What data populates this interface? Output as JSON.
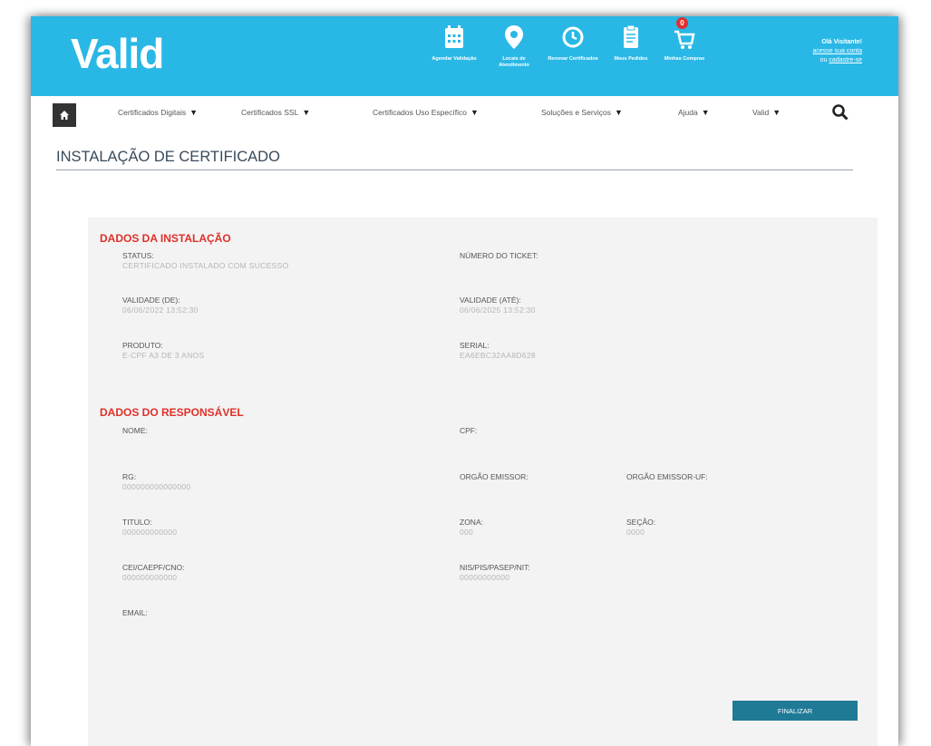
{
  "header": {
    "logo": "Valid",
    "icons": [
      {
        "name": "calendar-icon",
        "label": "Agendar Validação"
      },
      {
        "name": "location-pin-icon",
        "label": "Locais de Atendimento"
      },
      {
        "name": "renew-clock-icon",
        "label": "Renovar Certificados"
      },
      {
        "name": "clipboard-icon",
        "label": "Meus Pedidos"
      },
      {
        "name": "cart-icon",
        "label": "Minhas Compras"
      }
    ],
    "cart_count": "0",
    "user": {
      "greeting": "Olá Visitante!",
      "login_link": "acesse sua conta",
      "register_prefix": "ou",
      "register_link": "cadastre-se"
    }
  },
  "nav": {
    "items": [
      "Certificados Digitais",
      "Certificados SSL",
      "Certificados Uso Específico",
      "Soluções e Serviços",
      "Ajuda",
      "Valid"
    ]
  },
  "page": {
    "title": "INSTALAÇÃO DE CERTIFICADO"
  },
  "installation": {
    "heading": "DADOS DA INSTALAÇÃO",
    "status_label": "STATUS:",
    "status_value": "CERTIFICADO INSTALADO COM SUCESSO",
    "ticket_label": "NÚMERO DO TICKET:",
    "valid_from_label": "VALIDADE (DE):",
    "valid_from_value": "06/06/2022 13:52:30",
    "valid_to_label": "VALIDADE (ATÉ):",
    "valid_to_value": "06/06/2025 13:52:30",
    "product_label": "PRODUTO:",
    "product_value": "E-CPF A3 DE 3 ANOS",
    "serial_label": "SERIAL:",
    "serial_value": "EA6EBC32AA8D628"
  },
  "responsible": {
    "heading": "DADOS DO RESPONSÁVEL",
    "name_label": "NOME:",
    "cpf_label": "CPF:",
    "rg_label": "RG:",
    "rg_value": "000000000000000",
    "issuer_label": "ORGÃO EMISSOR:",
    "issuer_uf_label": "ORGÃO EMISSOR-UF:",
    "titulo_label": "TITULO:",
    "titulo_value": "000000000000",
    "zona_label": "ZONA:",
    "zona_value": "000",
    "secao_label": "SEÇÃO:",
    "secao_value": "0000",
    "cei_label": "CEI/CAEPF/CNO:",
    "cei_value": "000000000000",
    "nis_label": "NIS/PIS/PASEP/NIT:",
    "nis_value": "00000000000",
    "email_label": "EMAIL:"
  },
  "actions": {
    "finish_label": "FINALIZAR"
  },
  "colors": {
    "header_bg": "#29b8e6",
    "section_heading": "#e0302a",
    "button_bg": "#1f7a96"
  }
}
